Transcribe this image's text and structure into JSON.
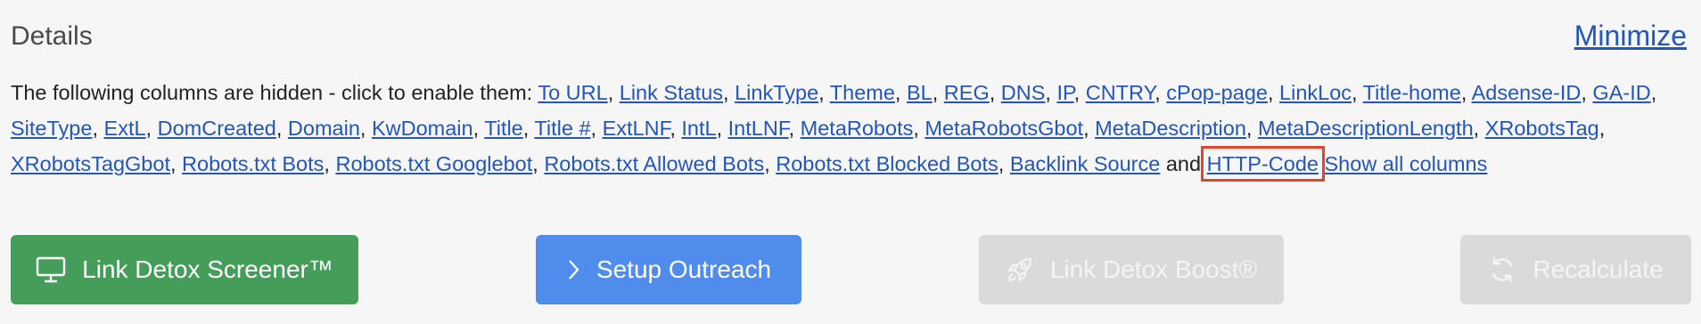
{
  "header": {
    "title": "Details",
    "minimize_label": "Minimize"
  },
  "hidden_columns": {
    "intro": "The following columns are hidden - click to enable them: ",
    "items": [
      "To URL",
      "Link Status",
      "LinkType",
      "Theme",
      "BL",
      "REG",
      "DNS",
      "IP",
      "CNTRY",
      "cPop-page",
      "LinkLoc",
      "Title-home",
      "Adsense-ID",
      "GA-ID",
      "SiteType",
      "ExtL",
      "DomCreated",
      "Domain",
      "KwDomain",
      "Title",
      "Title #",
      "ExtLNF",
      "IntL",
      "IntLNF",
      "MetaRobots",
      "MetaRobotsGbot",
      "MetaDescription",
      "MetaDescriptionLength",
      "XRobotsTag",
      "XRobotsTagGbot",
      "Robots.txt Bots",
      "Robots.txt Googlebot",
      "Robots.txt Allowed Bots",
      "Robots.txt Blocked Bots",
      "Backlink Source",
      "HTTP-Code"
    ],
    "conjunction": "and",
    "highlighted_item": "HTTP-Code",
    "show_all_label": "Show all columns"
  },
  "buttons": {
    "screener": {
      "label": "Link Detox Screener™",
      "icon": "monitor-icon",
      "color": "#459d5a"
    },
    "outreach": {
      "label": "Setup Outreach",
      "icon": "chevron-right-icon",
      "color": "#4f8cec"
    },
    "boost": {
      "label": "Link Detox Boost®",
      "icon": "rocket-icon",
      "disabled": true
    },
    "recalculate": {
      "label": "Recalculate",
      "icon": "refresh-icon",
      "disabled": true
    }
  },
  "colors": {
    "link": "#2356b8",
    "highlight": "#e0452d",
    "disabled_bg": "#dadada"
  }
}
